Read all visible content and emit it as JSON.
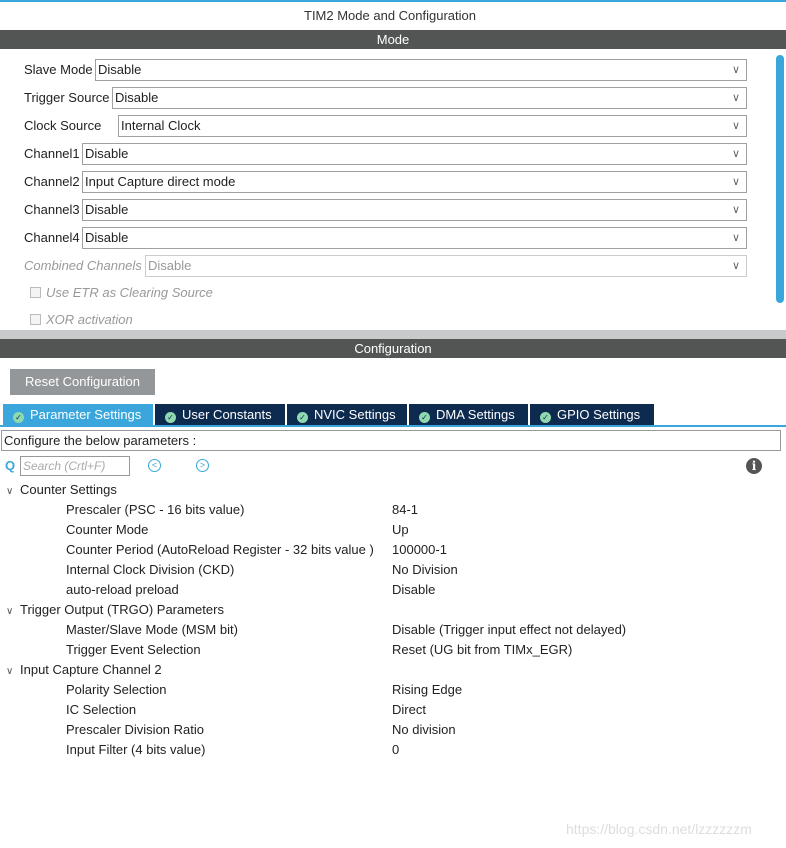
{
  "window_title": "TIM2 Mode and Configuration",
  "mode_header": "Mode",
  "mode_fields": [
    {
      "label": "Slave Mode",
      "value": "Disable"
    },
    {
      "label": "Trigger Source",
      "value": "Disable"
    },
    {
      "label": "Clock Source",
      "value": "Internal Clock"
    },
    {
      "label": "Channel1",
      "value": "Disable"
    },
    {
      "label": "Channel2",
      "value": "Input Capture direct mode"
    },
    {
      "label": "Channel3",
      "value": "Disable"
    },
    {
      "label": "Channel4",
      "value": "Disable"
    },
    {
      "label": "Combined Channels",
      "value": "Disable",
      "disabled": true
    }
  ],
  "checkboxes": [
    {
      "label": "Use ETR as Clearing Source",
      "checked": false,
      "disabled": true
    },
    {
      "label": "XOR activation",
      "checked": false,
      "disabled": true
    }
  ],
  "config_header": "Configuration",
  "reset_label": "Reset Configuration",
  "tabs": [
    {
      "label": "Parameter Settings",
      "active": true
    },
    {
      "label": "User Constants"
    },
    {
      "label": "NVIC Settings"
    },
    {
      "label": "DMA Settings"
    },
    {
      "label": "GPIO Settings"
    }
  ],
  "configure_text": "Configure the below parameters :",
  "search_placeholder": "Search (Crtl+F)",
  "groups": [
    {
      "name": "Counter Settings",
      "params": [
        {
          "name": "Prescaler (PSC - 16 bits value)",
          "value": "84-1"
        },
        {
          "name": "Counter Mode",
          "value": "Up"
        },
        {
          "name": "Counter Period (AutoReload Register - 32 bits value )",
          "value": "100000-1"
        },
        {
          "name": "Internal Clock Division (CKD)",
          "value": "No Division"
        },
        {
          "name": "auto-reload preload",
          "value": "Disable"
        }
      ]
    },
    {
      "name": "Trigger Output (TRGO) Parameters",
      "params": [
        {
          "name": "Master/Slave Mode (MSM bit)",
          "value": "Disable (Trigger input effect not delayed)"
        },
        {
          "name": "Trigger Event Selection",
          "value": "Reset (UG bit from TIMx_EGR)"
        }
      ]
    },
    {
      "name": "Input Capture Channel 2",
      "params": [
        {
          "name": "Polarity Selection",
          "value": "Rising Edge"
        },
        {
          "name": "IC Selection",
          "value": "Direct"
        },
        {
          "name": "Prescaler Division Ratio",
          "value": "No division"
        },
        {
          "name": "Input Filter (4 bits value)",
          "value": "0"
        }
      ]
    }
  ],
  "watermark": "https://blog.csdn.net/lzzzzzzm"
}
